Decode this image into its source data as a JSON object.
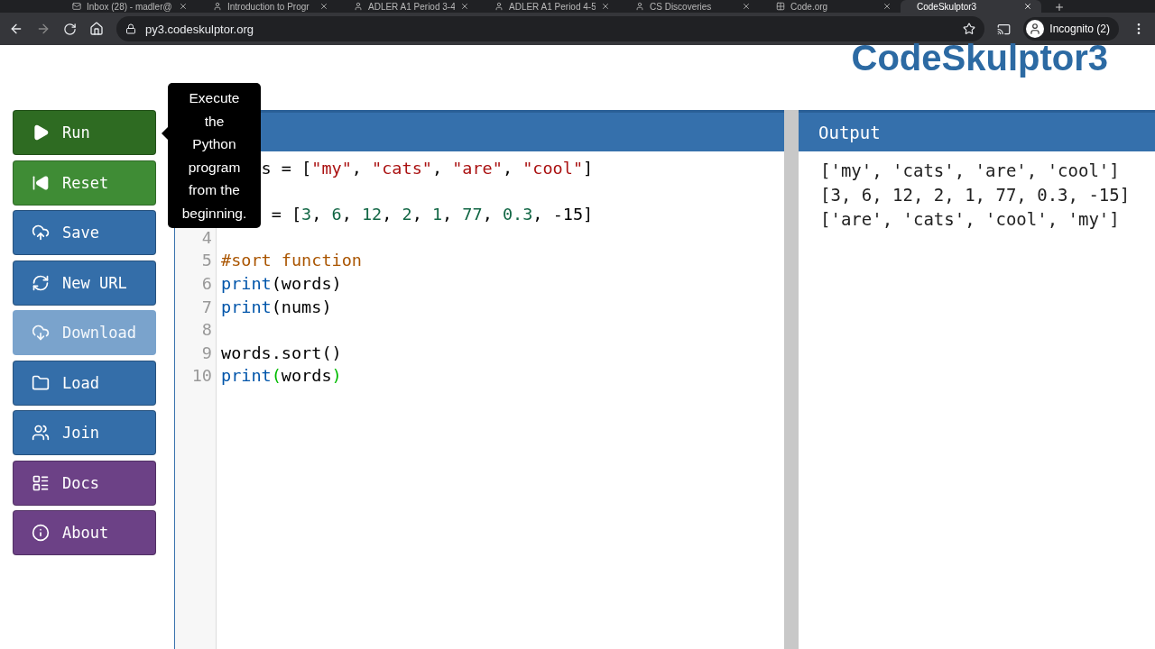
{
  "browser": {
    "tabs": [
      {
        "title": "Inbox (28) - madler@",
        "selected": false
      },
      {
        "title": "Introduction to Progr",
        "selected": false
      },
      {
        "title": "ADLER A1 Period 3-4",
        "selected": false
      },
      {
        "title": "ADLER A1 Period 4-5",
        "selected": false
      },
      {
        "title": "CS Discoveries",
        "selected": false
      },
      {
        "title": "Code.org",
        "selected": false
      },
      {
        "title": "CodeSkulptor3",
        "selected": true
      }
    ],
    "url": "py3.codeskulptor.org",
    "profile": "Incognito (2)"
  },
  "logo": "CodeSkulptor3",
  "sidebar": {
    "buttons": [
      {
        "label": "Run",
        "kind": "run",
        "color": "#2e6b22",
        "disabled": false
      },
      {
        "label": "Reset",
        "kind": "reset",
        "color": "#3f8c35",
        "disabled": false
      },
      {
        "label": "Save",
        "kind": "save",
        "color": "#346ea9",
        "disabled": false
      },
      {
        "label": "New URL",
        "kind": "new-url",
        "color": "#346ea9",
        "disabled": false
      },
      {
        "label": "Download",
        "kind": "download",
        "color": "#7aa3cc",
        "disabled": true
      },
      {
        "label": "Load",
        "kind": "load",
        "color": "#346ea9",
        "disabled": false
      },
      {
        "label": "Join",
        "kind": "join",
        "color": "#346ea9",
        "disabled": false
      },
      {
        "label": "Docs",
        "kind": "docs",
        "color": "#6c4186",
        "disabled": false
      },
      {
        "label": "About",
        "kind": "about",
        "color": "#6c4186",
        "disabled": false
      }
    ]
  },
  "tooltip": "Execute the Python program from the beginning.",
  "editor": {
    "lines": [
      {
        "kind": "code",
        "tokens": [
          {
            "text": "    s = [",
            "kind": "plain"
          },
          {
            "text": "\"my\"",
            "kind": "string"
          },
          {
            "text": ", ",
            "kind": "plain"
          },
          {
            "text": "\"cats\"",
            "kind": "string"
          },
          {
            "text": ", ",
            "kind": "plain"
          },
          {
            "text": "\"are\"",
            "kind": "string"
          },
          {
            "text": ", ",
            "kind": "plain"
          },
          {
            "text": "\"cool\"",
            "kind": "string"
          },
          {
            "text": "]",
            "kind": "plain"
          }
        ]
      },
      {
        "kind": "blank"
      },
      {
        "kind": "code",
        "tokens": [
          {
            "text": "     = [",
            "kind": "plain"
          },
          {
            "text": "3",
            "kind": "number"
          },
          {
            "text": ", ",
            "kind": "plain"
          },
          {
            "text": "6",
            "kind": "number"
          },
          {
            "text": ", ",
            "kind": "plain"
          },
          {
            "text": "12",
            "kind": "number"
          },
          {
            "text": ", ",
            "kind": "plain"
          },
          {
            "text": "2",
            "kind": "number"
          },
          {
            "text": ", ",
            "kind": "plain"
          },
          {
            "text": "1",
            "kind": "number"
          },
          {
            "text": ", ",
            "kind": "plain"
          },
          {
            "text": "77",
            "kind": "number"
          },
          {
            "text": ", ",
            "kind": "plain"
          },
          {
            "text": "0.3",
            "kind": "number"
          },
          {
            "text": ", ",
            "kind": "plain"
          },
          {
            "text": "-15",
            "kind": "plain"
          },
          {
            "text": "]",
            "kind": "plain"
          }
        ]
      },
      {
        "kind": "blank",
        "number": "4"
      },
      {
        "kind": "code",
        "number": "5",
        "tokens": [
          {
            "text": "#sort function",
            "kind": "comment"
          }
        ]
      },
      {
        "kind": "code",
        "number": "6",
        "tokens": [
          {
            "text": "print",
            "kind": "builtin"
          },
          {
            "text": "(words)",
            "kind": "plain"
          }
        ]
      },
      {
        "kind": "code",
        "number": "7",
        "tokens": [
          {
            "text": "print",
            "kind": "builtin"
          },
          {
            "text": "(nums)",
            "kind": "plain"
          }
        ]
      },
      {
        "kind": "blank",
        "number": "8"
      },
      {
        "kind": "code",
        "number": "9",
        "tokens": [
          {
            "text": "words.sort()",
            "kind": "plain"
          }
        ]
      },
      {
        "kind": "code",
        "number": "10",
        "tokens": [
          {
            "text": "print",
            "kind": "builtin"
          },
          {
            "text": "(",
            "kind": "match"
          },
          {
            "text": "words",
            "kind": "plain"
          },
          {
            "text": ")",
            "kind": "match"
          }
        ]
      }
    ]
  },
  "output": {
    "title": "Output",
    "lines": [
      "['my', 'cats', 'are', 'cool']",
      "[3, 6, 12, 2, 1, 77, 0.3, -15]",
      "['are', 'cats', 'cool', 'my']"
    ]
  }
}
